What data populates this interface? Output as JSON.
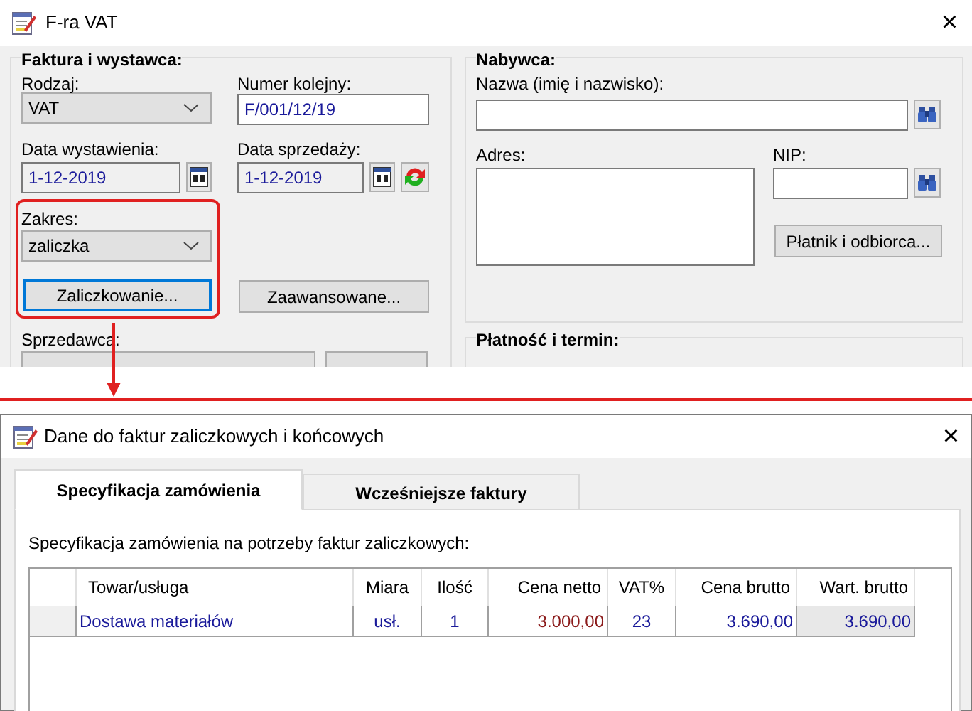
{
  "top_window": {
    "title": "F-ra VAT",
    "close": "×",
    "invoice_group": {
      "title": "Faktura i wystawca:",
      "type": {
        "label": "Rodzaj:",
        "value": "VAT"
      },
      "number": {
        "label": "Numer kolejny:",
        "value": "F/001/12/19"
      },
      "issue_date": {
        "label": "Data wystawienia:",
        "value": "1-12-2019"
      },
      "sale_date": {
        "label": "Data sprzedaży:",
        "value": "1-12-2019"
      },
      "scope": {
        "label": "Zakres:",
        "value": "zaliczka"
      },
      "buttons": [
        {
          "label": "Zaliczkowanie...",
          "focused": true
        },
        {
          "label": "Zaawansowane...",
          "focused": false
        }
      ],
      "seller": {
        "label": "Sprzedawca:"
      }
    },
    "buyer_group": {
      "title": "Nabywca:",
      "name": {
        "label": "Nazwa (imię i nazwisko):"
      },
      "address": {
        "label": "Adres:"
      },
      "nip": {
        "label": "NIP:"
      },
      "payer_button": "Płatnik i odbiorca..."
    },
    "payment_group": {
      "title": "Płatność i termin:"
    }
  },
  "bottom_window": {
    "title": "Dane do faktur zaliczkowych i końcowych",
    "close": "×",
    "tabs": [
      {
        "label": "Specyfikacja zamówienia",
        "selected": true
      },
      {
        "label": "Wcześniejsze faktury",
        "selected": false
      }
    ],
    "description": "Specyfikacja zamówienia na potrzeby faktur zaliczkowych:",
    "table": {
      "columns": [
        "Towar/usługa",
        "Miara",
        "Ilość",
        "Cena netto",
        "VAT%",
        "Cena brutto",
        "Wart. brutto"
      ],
      "rows": [
        [
          "Dostawa materiałów",
          "usł.",
          "1",
          "3.000,00",
          "23",
          "3.690,00",
          "3.690,00"
        ]
      ]
    }
  }
}
